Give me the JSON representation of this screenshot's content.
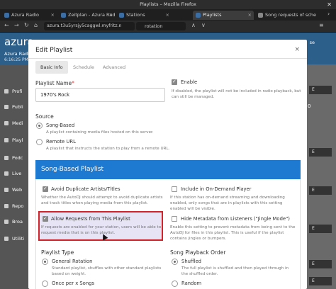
{
  "window": {
    "title": "Playlists – Mozilla Firefox"
  },
  "tabs": [
    {
      "label": "Azura Radio",
      "color": "#3b6ea5"
    },
    {
      "label": "Zeitplan - Azura Radio",
      "color": "#3b6ea5"
    },
    {
      "label": "Stations",
      "color": "#3b6ea5"
    },
    {
      "label": "Playlists",
      "color": "#3b6ea5"
    },
    {
      "label": "Song requests of sche",
      "color": "#888888"
    }
  ],
  "navbar": {
    "url": "azura.t3u5yrsjy5caggwl.myfritz.n",
    "find_text": "rotation"
  },
  "background": {
    "brand": "azura",
    "station_name": "Azura Radi",
    "time": "6:16:25 PM",
    "right_link": "se",
    "sidebar": [
      "Profi",
      "Publi",
      "Medi",
      "Playl",
      "Podc",
      "Live",
      "Web",
      "Repo",
      "Broa",
      "Utiliti"
    ],
    "right_buttons": [
      "E",
      "E",
      "E",
      "E",
      "E",
      "E",
      "E"
    ],
    "right_number": "0"
  },
  "modal": {
    "title": "Edit Playlist",
    "close": "×",
    "tabs": [
      "Basic Info",
      "Schedule",
      "Advanced"
    ],
    "name_label": "Playlist Name",
    "name_required": "*",
    "name_value": "1970's Rock",
    "enable_label": "Enable",
    "enable_help": "If disabled, the playlist will not be included in radio playback, but can still be managed.",
    "source_label": "Source",
    "source_options": [
      {
        "label": "Song-Based",
        "help": "A playlist containing media files hosted on this server."
      },
      {
        "label": "Remote URL",
        "help": "A playlist that instructs the station to play from a remote URL."
      }
    ],
    "panel_title": "Song-Based Playlist",
    "checkboxes": {
      "avoid_duplicates": {
        "label": "Avoid Duplicate Artists/Titles",
        "help": "Whether the AutoDJ should attempt to avoid duplicate artists and track titles when playing media from this playlist."
      },
      "on_demand": {
        "label": "Include in On-Demand Player",
        "help": "If this station has on-demand streaming and downloading enabled, only songs that are in playlists with this setting enabled will be visible."
      },
      "allow_requests": {
        "label": "Allow Requests from This Playlist",
        "help": "If requests are enabled for your station, users will be able to request media that is on this playlist."
      },
      "hide_metadata": {
        "label": "Hide Metadata from Listeners (\"Jingle Mode\")",
        "help": "Enable this setting to prevent metadata from being sent to the AutoDJ for files in this playlist. This is useful if the playlist contains jingles or bumpers."
      }
    },
    "playlist_type_label": "Playlist Type",
    "playlist_types": [
      {
        "label": "General Rotation",
        "help": "Standard playlist, shuffles with other standard playlists based on weight."
      },
      {
        "label": "Once per x Songs",
        "help": ""
      }
    ],
    "playback_order_label": "Song Playback Order",
    "playback_orders": [
      {
        "label": "Shuffled",
        "help": "The full playlist is shuffled and then played through in the shuffled order."
      },
      {
        "label": "Random",
        "help": ""
      }
    ]
  }
}
